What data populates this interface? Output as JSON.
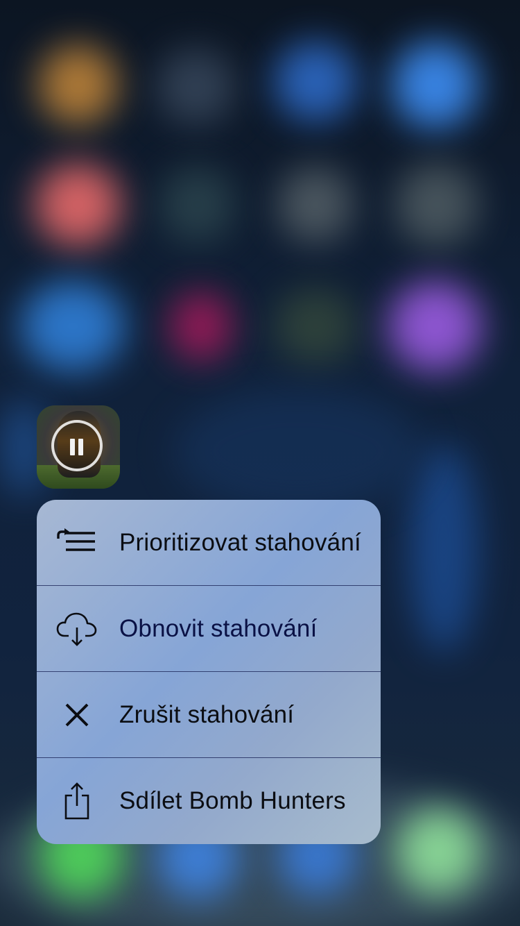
{
  "app": {
    "name": "Bomb Hunters",
    "download_state": "paused"
  },
  "quick_actions": [
    {
      "id": "prioritize",
      "icon": "prioritize-list-icon",
      "label": "Prioritizovat stahování"
    },
    {
      "id": "resume",
      "icon": "cloud-download-icon",
      "label": "Obnovit stahování"
    },
    {
      "id": "cancel",
      "icon": "close-icon",
      "label": "Zrušit stahování"
    },
    {
      "id": "share",
      "icon": "share-icon",
      "label": "Sdílet Bomb Hunters"
    }
  ],
  "colors": {
    "menu_background": "#8faad6",
    "divider": "#141e50",
    "label_text": "#0b0d12",
    "resume_label_text": "#0a1145"
  }
}
